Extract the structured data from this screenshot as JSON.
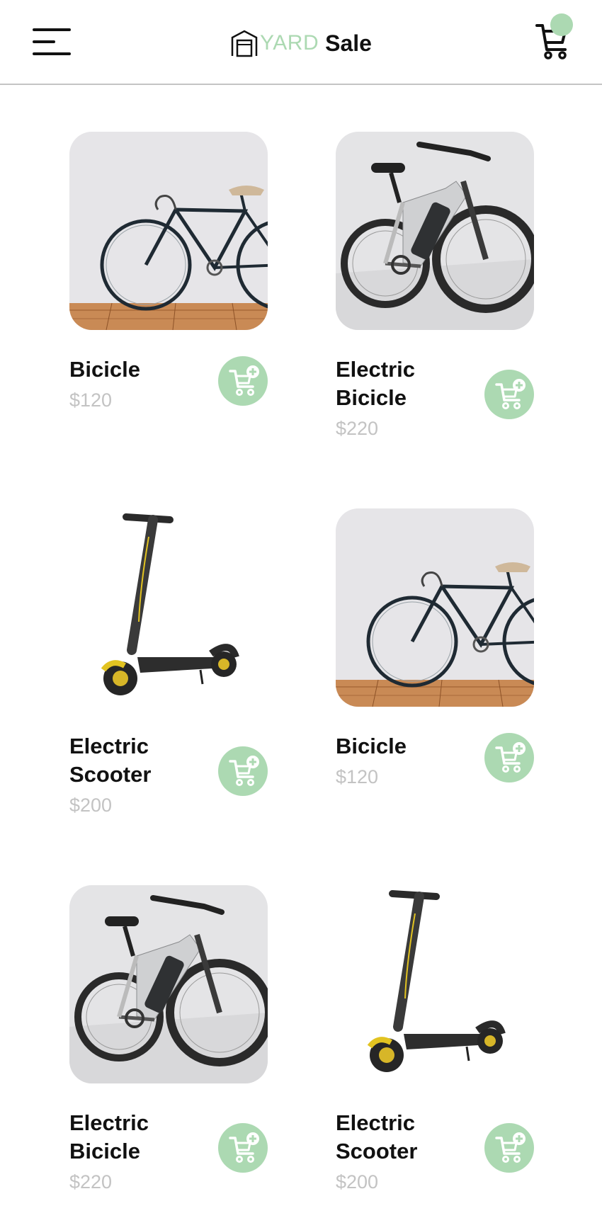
{
  "header": {
    "brand_accent": "YARD",
    "brand_main": "Sale",
    "menu_icon": "hamburger-menu-icon",
    "cart_icon": "shopping-cart-icon",
    "accent_color": "#acd9b2"
  },
  "products": [
    {
      "name": "Bicicle",
      "price": "$120",
      "image": "bicycle-photo",
      "button_icon": "add-to-cart-icon"
    },
    {
      "name": "Electric Bicicle",
      "price": "$220",
      "image": "electric-bicycle-photo",
      "button_icon": "add-to-cart-icon"
    },
    {
      "name": "Electric Scooter",
      "price": "$200",
      "image": "electric-scooter-photo",
      "button_icon": "add-to-cart-icon"
    },
    {
      "name": "Bicicle",
      "price": "$120",
      "image": "bicycle-photo",
      "button_icon": "add-to-cart-icon"
    },
    {
      "name": "Electric Bicicle",
      "price": "$220",
      "image": "electric-bicycle-photo",
      "button_icon": "add-to-cart-icon"
    },
    {
      "name": "Electric Scooter",
      "price": "$200",
      "image": "electric-scooter-photo",
      "button_icon": "add-to-cart-icon"
    }
  ]
}
